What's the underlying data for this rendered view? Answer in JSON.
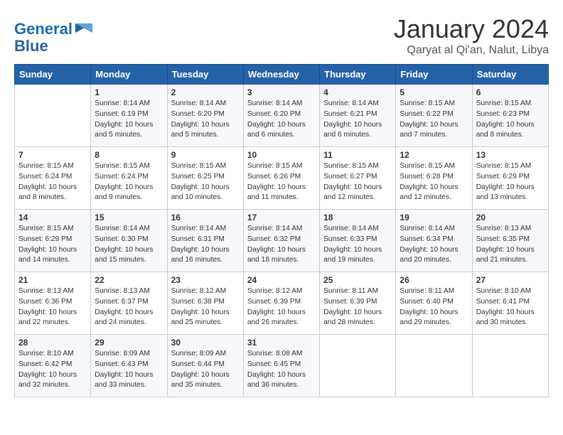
{
  "header": {
    "logo_line1": "General",
    "logo_line2": "Blue",
    "month": "January 2024",
    "location": "Qaryat al Qi'an, Nalut, Libya"
  },
  "days_of_week": [
    "Sunday",
    "Monday",
    "Tuesday",
    "Wednesday",
    "Thursday",
    "Friday",
    "Saturday"
  ],
  "weeks": [
    [
      {
        "day": "",
        "info": ""
      },
      {
        "day": "1",
        "info": "Sunrise: 8:14 AM\nSunset: 6:19 PM\nDaylight: 10 hours\nand 5 minutes."
      },
      {
        "day": "2",
        "info": "Sunrise: 8:14 AM\nSunset: 6:20 PM\nDaylight: 10 hours\nand 5 minutes."
      },
      {
        "day": "3",
        "info": "Sunrise: 8:14 AM\nSunset: 6:20 PM\nDaylight: 10 hours\nand 6 minutes."
      },
      {
        "day": "4",
        "info": "Sunrise: 8:14 AM\nSunset: 6:21 PM\nDaylight: 10 hours\nand 6 minutes."
      },
      {
        "day": "5",
        "info": "Sunrise: 8:15 AM\nSunset: 6:22 PM\nDaylight: 10 hours\nand 7 minutes."
      },
      {
        "day": "6",
        "info": "Sunrise: 8:15 AM\nSunset: 6:23 PM\nDaylight: 10 hours\nand 8 minutes."
      }
    ],
    [
      {
        "day": "7",
        "info": "Sunrise: 8:15 AM\nSunset: 6:24 PM\nDaylight: 10 hours\nand 8 minutes."
      },
      {
        "day": "8",
        "info": "Sunrise: 8:15 AM\nSunset: 6:24 PM\nDaylight: 10 hours\nand 9 minutes."
      },
      {
        "day": "9",
        "info": "Sunrise: 8:15 AM\nSunset: 6:25 PM\nDaylight: 10 hours\nand 10 minutes."
      },
      {
        "day": "10",
        "info": "Sunrise: 8:15 AM\nSunset: 6:26 PM\nDaylight: 10 hours\nand 11 minutes."
      },
      {
        "day": "11",
        "info": "Sunrise: 8:15 AM\nSunset: 6:27 PM\nDaylight: 10 hours\nand 12 minutes."
      },
      {
        "day": "12",
        "info": "Sunrise: 8:15 AM\nSunset: 6:28 PM\nDaylight: 10 hours\nand 12 minutes."
      },
      {
        "day": "13",
        "info": "Sunrise: 8:15 AM\nSunset: 6:29 PM\nDaylight: 10 hours\nand 13 minutes."
      }
    ],
    [
      {
        "day": "14",
        "info": "Sunrise: 8:15 AM\nSunset: 6:29 PM\nDaylight: 10 hours\nand 14 minutes."
      },
      {
        "day": "15",
        "info": "Sunrise: 8:14 AM\nSunset: 6:30 PM\nDaylight: 10 hours\nand 15 minutes."
      },
      {
        "day": "16",
        "info": "Sunrise: 8:14 AM\nSunset: 6:31 PM\nDaylight: 10 hours\nand 16 minutes."
      },
      {
        "day": "17",
        "info": "Sunrise: 8:14 AM\nSunset: 6:32 PM\nDaylight: 10 hours\nand 18 minutes."
      },
      {
        "day": "18",
        "info": "Sunrise: 8:14 AM\nSunset: 6:33 PM\nDaylight: 10 hours\nand 19 minutes."
      },
      {
        "day": "19",
        "info": "Sunrise: 8:14 AM\nSunset: 6:34 PM\nDaylight: 10 hours\nand 20 minutes."
      },
      {
        "day": "20",
        "info": "Sunrise: 8:13 AM\nSunset: 6:35 PM\nDaylight: 10 hours\nand 21 minutes."
      }
    ],
    [
      {
        "day": "21",
        "info": "Sunrise: 8:13 AM\nSunset: 6:36 PM\nDaylight: 10 hours\nand 22 minutes."
      },
      {
        "day": "22",
        "info": "Sunrise: 8:13 AM\nSunset: 6:37 PM\nDaylight: 10 hours\nand 24 minutes."
      },
      {
        "day": "23",
        "info": "Sunrise: 8:12 AM\nSunset: 6:38 PM\nDaylight: 10 hours\nand 25 minutes."
      },
      {
        "day": "24",
        "info": "Sunrise: 8:12 AM\nSunset: 6:39 PM\nDaylight: 10 hours\nand 26 minutes."
      },
      {
        "day": "25",
        "info": "Sunrise: 8:11 AM\nSunset: 6:39 PM\nDaylight: 10 hours\nand 28 minutes."
      },
      {
        "day": "26",
        "info": "Sunrise: 8:11 AM\nSunset: 6:40 PM\nDaylight: 10 hours\nand 29 minutes."
      },
      {
        "day": "27",
        "info": "Sunrise: 8:10 AM\nSunset: 6:41 PM\nDaylight: 10 hours\nand 30 minutes."
      }
    ],
    [
      {
        "day": "28",
        "info": "Sunrise: 8:10 AM\nSunset: 6:42 PM\nDaylight: 10 hours\nand 32 minutes."
      },
      {
        "day": "29",
        "info": "Sunrise: 8:09 AM\nSunset: 6:43 PM\nDaylight: 10 hours\nand 33 minutes."
      },
      {
        "day": "30",
        "info": "Sunrise: 8:09 AM\nSunset: 6:44 PM\nDaylight: 10 hours\nand 35 minutes."
      },
      {
        "day": "31",
        "info": "Sunrise: 8:08 AM\nSunset: 6:45 PM\nDaylight: 10 hours\nand 36 minutes."
      },
      {
        "day": "",
        "info": ""
      },
      {
        "day": "",
        "info": ""
      },
      {
        "day": "",
        "info": ""
      }
    ]
  ]
}
